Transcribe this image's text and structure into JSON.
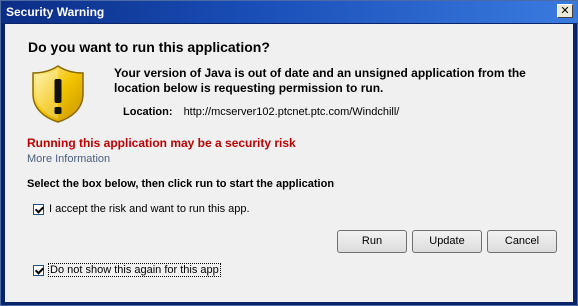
{
  "window": {
    "title": "Security Warning",
    "close_glyph": "✕"
  },
  "dialog": {
    "heading": "Do you want to run this application?",
    "message": "Your version of Java is out of date and an unsigned application from the location below is requesting permission to run.",
    "location_label": "Location:",
    "location_value": "http://mcserver102.ptcnet.ptc.com/Windchill/",
    "risk_text": "Running this application may be a security risk",
    "more_info_link": "More Information",
    "instruction": "Select the box below, then click run to start the application",
    "accept_checkbox_label": "I accept the risk and want to run this app.",
    "accept_checked": true,
    "dont_show_label": "Do not show this again for this app",
    "dont_show_checked": true
  },
  "buttons": {
    "run": "Run",
    "update": "Update",
    "cancel": "Cancel"
  },
  "icons": {
    "warning": "warning-shield-icon"
  },
  "colors": {
    "risk_text": "#c00000",
    "link": "#4a5d7e",
    "titlebar_start": "#0b2d86",
    "titlebar_end": "#3a7be0",
    "shield_yellow": "#f2c300"
  }
}
